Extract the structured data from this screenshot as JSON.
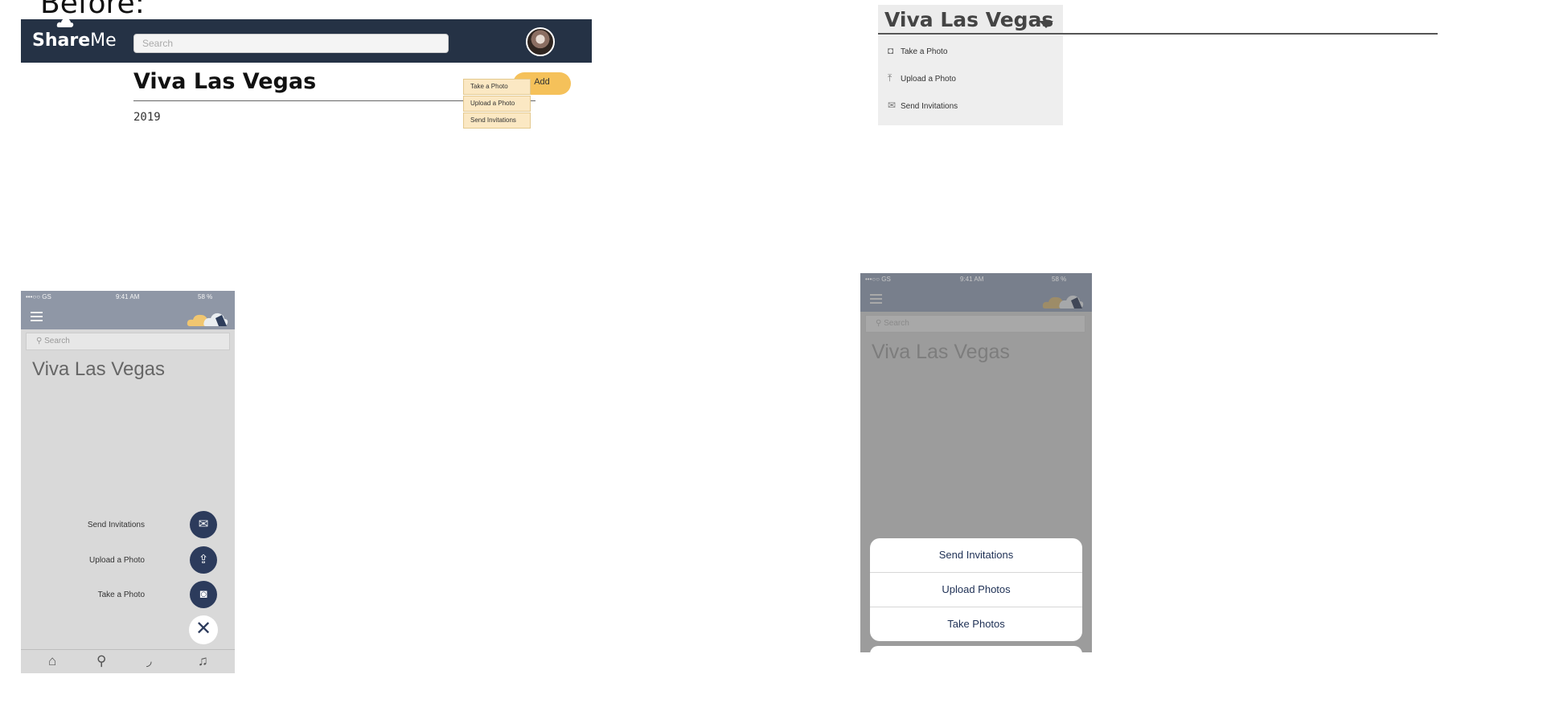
{
  "heading": "Before:",
  "desktop_before": {
    "logo": {
      "bold": "Share",
      "thin": "Me"
    },
    "search_placeholder": "Search",
    "title": "Viva Las Vegas",
    "year": "2019",
    "add_label": "Add",
    "menu": [
      "Take a Photo",
      "Upload a Photo",
      "Send Invitations"
    ]
  },
  "desktop_after": {
    "title": "Viva Las Vegas",
    "menu": [
      {
        "icon": "camera-icon",
        "label": "Take a Photo"
      },
      {
        "icon": "upload-icon",
        "label": "Upload a Photo"
      },
      {
        "icon": "envelope-icon",
        "label": "Send Invitations"
      }
    ]
  },
  "mobile_before": {
    "status": {
      "carrier": "•••○○ GS",
      "time": "9:41 AM",
      "battery": "58 %"
    },
    "search_placeholder": "Search",
    "title": "Viva Las Vegas",
    "fab_actions": [
      {
        "label": "Send Invitations",
        "icon": "envelope-icon"
      },
      {
        "label": "Upload a Photo",
        "icon": "cloud-upload-icon"
      },
      {
        "label": "Take a Photo",
        "icon": "camera-icon"
      }
    ],
    "tabs": [
      "home-icon",
      "search-icon",
      "feed-icon",
      "notification-icon"
    ]
  },
  "mobile_after": {
    "status": {
      "carrier": "•••○○ GS",
      "time": "9:41 AM",
      "battery": "58 %"
    },
    "search_placeholder": "Search",
    "title": "Viva Las Vegas",
    "sheet": [
      "Send Invitations",
      "Upload Photos",
      "Take Photos"
    ]
  }
}
